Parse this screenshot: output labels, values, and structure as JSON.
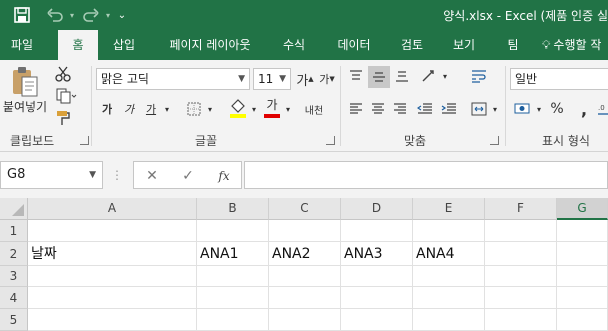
{
  "titlebar": {
    "title": "양식.xlsx - Excel (제품 인증 실",
    "save_icon": "save-icon",
    "undo_icon": "undo-icon",
    "redo_icon": "redo-icon",
    "customize_icon": "customize-qat-icon",
    "color": "#217346"
  },
  "tabs": [
    {
      "label": "파일"
    },
    {
      "label": "홈"
    },
    {
      "label": "삽입"
    },
    {
      "label": "페이지 레이아웃"
    },
    {
      "label": "수식"
    },
    {
      "label": "데이터"
    },
    {
      "label": "검토"
    },
    {
      "label": "보기"
    },
    {
      "label": "팀"
    },
    {
      "label": "수행할 작"
    }
  ],
  "ribbon": {
    "clipboard": {
      "paste_label": "붙여넣기",
      "group_label": "클립보드"
    },
    "font": {
      "name": "맑은 고딕",
      "size": "11",
      "grow": "가",
      "shrink": "가",
      "bold": "가",
      "italic": "가",
      "underline": "가",
      "font_color_letter": "가",
      "phonetic": "내천",
      "group_label": "글꼴",
      "highlight_color": "#ffff00",
      "font_color": "#e00000"
    },
    "alignment": {
      "group_label": "맞춤"
    },
    "number": {
      "format": "일반",
      "percent": "%",
      "comma": ",",
      "group_label": "표시 형식"
    }
  },
  "formula_bar": {
    "name_box": "G8",
    "fx": "fx",
    "cancel": "✕",
    "enter": "✓",
    "value": ""
  },
  "grid": {
    "columns": [
      "A",
      "B",
      "C",
      "D",
      "E",
      "F",
      "G"
    ],
    "selected_column": "G",
    "rows": [
      {
        "num": "1",
        "cells": [
          "",
          "",
          "",
          "",
          "",
          "",
          ""
        ]
      },
      {
        "num": "2",
        "cells": [
          "날짜",
          "ANA1",
          "ANA2",
          "ANA3",
          "ANA4",
          "",
          ""
        ]
      },
      {
        "num": "3",
        "cells": [
          "",
          "",
          "",
          "",
          "",
          "",
          ""
        ]
      },
      {
        "num": "4",
        "cells": [
          "",
          "",
          "",
          "",
          "",
          "",
          ""
        ]
      },
      {
        "num": "5",
        "cells": [
          "",
          "",
          "",
          "",
          "",
          "",
          ""
        ]
      }
    ]
  }
}
